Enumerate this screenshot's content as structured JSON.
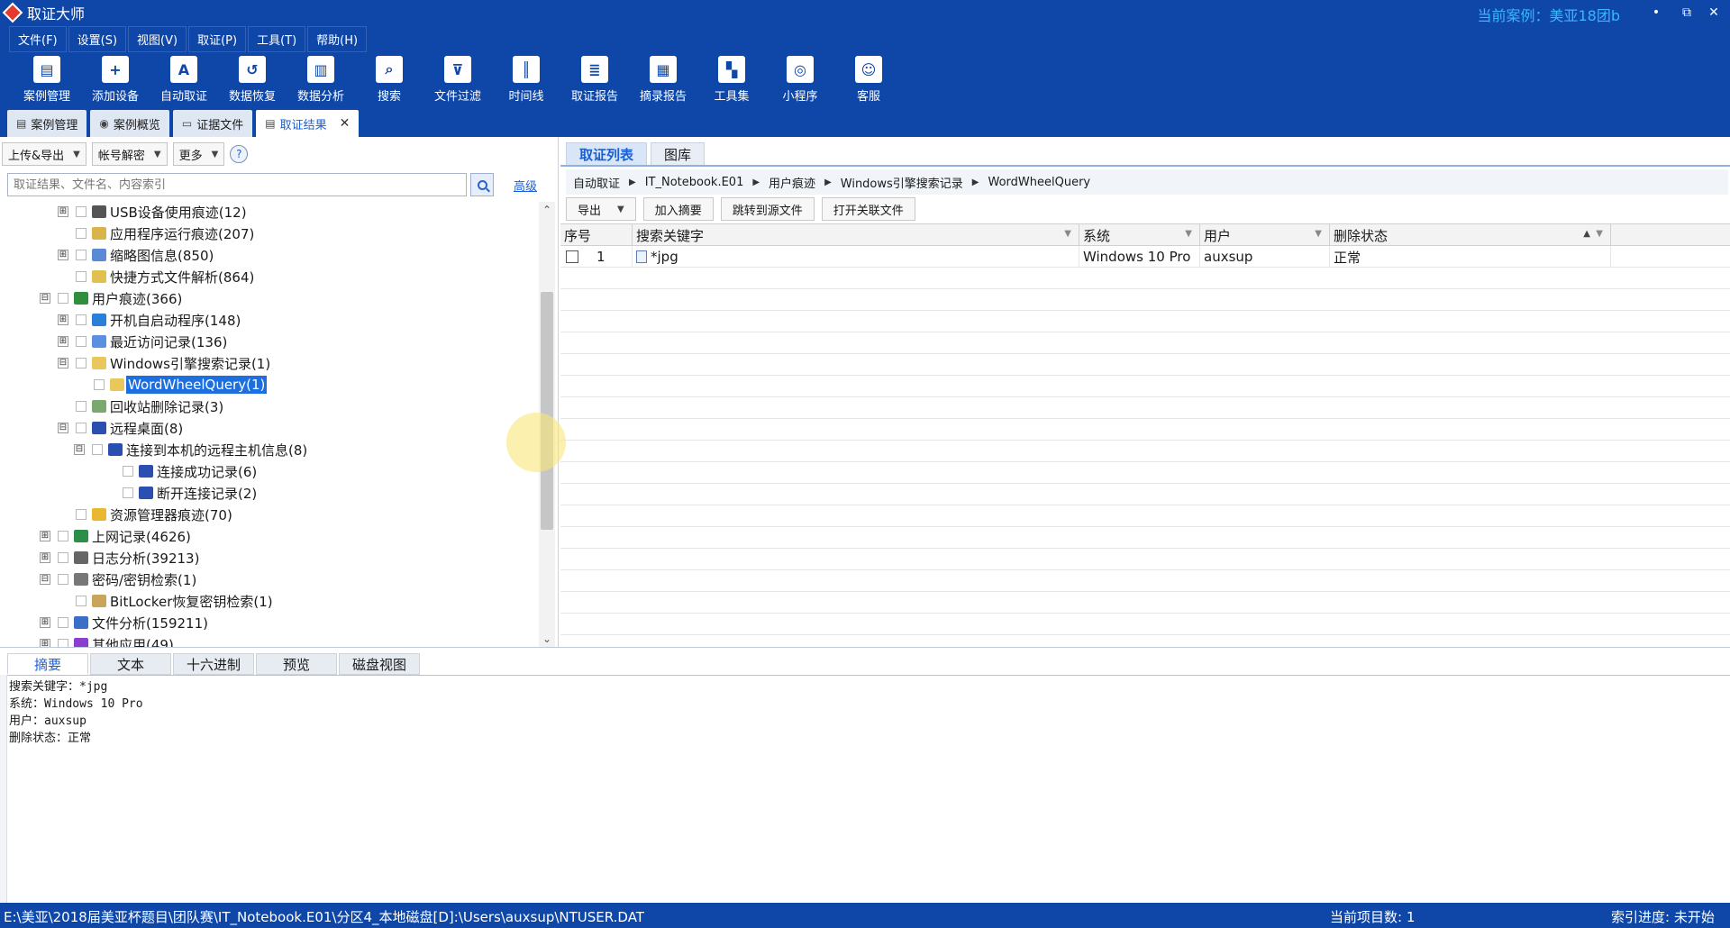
{
  "window": {
    "title": "取证大师",
    "current_case": "当前案例：美亚18团b",
    "minimize": "•",
    "restore": "⧉",
    "close": "✕"
  },
  "menu": [
    "文件(F)",
    "设置(S)",
    "视图(V)",
    "取证(P)",
    "工具(T)",
    "帮助(H)"
  ],
  "ribbon": [
    {
      "label": "案例管理",
      "icon": "folder-icon"
    },
    {
      "label": "添加设备",
      "icon": "add-device-icon"
    },
    {
      "label": "自动取证",
      "icon": "auto-icon"
    },
    {
      "label": "数据恢复",
      "icon": "recover-icon"
    },
    {
      "label": "数据分析",
      "icon": "analysis-icon"
    },
    {
      "label": "搜索",
      "icon": "search-icon"
    },
    {
      "label": "文件过滤",
      "icon": "filter-icon"
    },
    {
      "label": "时间线",
      "icon": "timeline-icon"
    },
    {
      "label": "取证报告",
      "icon": "report-icon"
    },
    {
      "label": "摘录报告",
      "icon": "excerpt-icon"
    },
    {
      "label": "工具集",
      "icon": "tools-icon"
    },
    {
      "label": "小程序",
      "icon": "miniapp-icon"
    },
    {
      "label": "客服",
      "icon": "support-icon"
    }
  ],
  "doc_tabs": [
    "案例管理",
    "案例概览",
    "证据文件",
    "取证结果"
  ],
  "left": {
    "upload_export": "上传&导出",
    "account_decrypt": "帐号解密",
    "more": "更多",
    "help": "?",
    "search_placeholder": "取证结果、文件名、内容索引",
    "advanced": "高级"
  },
  "tree": [
    {
      "label": "USB设备使用痕迹(12)",
      "exp": "⊞"
    },
    {
      "label": "应用程序运行痕迹(207)",
      "exp": ""
    },
    {
      "label": "缩略图信息(850)",
      "exp": "⊞"
    },
    {
      "label": "快捷方式文件解析(864)",
      "exp": ""
    },
    {
      "label": "用户痕迹(366)",
      "exp": "⊟"
    },
    {
      "label": "开机自启动程序(148)",
      "exp": "⊞"
    },
    {
      "label": "最近访问记录(136)",
      "exp": "⊞"
    },
    {
      "label": "Windows引擎搜索记录(1)",
      "exp": "⊟"
    },
    {
      "label": "WordWheelQuery(1)",
      "exp": ""
    },
    {
      "label": "回收站删除记录(3)",
      "exp": ""
    },
    {
      "label": "远程桌面(8)",
      "exp": "⊟"
    },
    {
      "label": "连接到本机的远程主机信息(8)",
      "exp": "⊟"
    },
    {
      "label": "连接成功记录(6)",
      "exp": ""
    },
    {
      "label": "断开连接记录(2)",
      "exp": ""
    },
    {
      "label": "资源管理器痕迹(70)",
      "exp": ""
    },
    {
      "label": "上网记录(4626)",
      "exp": "⊞"
    },
    {
      "label": "日志分析(39213)",
      "exp": "⊞"
    },
    {
      "label": "密码/密钥检索(1)",
      "exp": "⊟"
    },
    {
      "label": "BitLocker恢复密钥检索(1)",
      "exp": ""
    },
    {
      "label": "文件分析(159211)",
      "exp": "⊞"
    },
    {
      "label": "其他应用(49)",
      "exp": "⊞"
    }
  ],
  "right": {
    "tabs": [
      "取证列表",
      "图库"
    ],
    "breadcrumb": [
      "自动取证",
      "IT_Notebook.E01",
      "用户痕迹",
      "Windows引擎搜索记录",
      "WordWheelQuery"
    ],
    "export": "导出",
    "add_summary": "加入摘要",
    "jump_source": "跳转到源文件",
    "open_related": "打开关联文件",
    "columns": [
      "序号",
      "搜索关键字",
      "系统",
      "用户",
      "删除状态"
    ],
    "rows": [
      {
        "index": "1",
        "keyword": "*jpg",
        "system": "Windows 10 Pro",
        "user": "auxsup",
        "deleted": "正常"
      }
    ]
  },
  "bottom": {
    "tabs": [
      "摘要",
      "文本",
      "十六进制",
      "预览",
      "磁盘视图"
    ],
    "summary_lines": [
      "搜索关键字：*jpg",
      "系统：Windows 10 Pro",
      "用户：auxsup",
      "删除状态：正常"
    ]
  },
  "status": {
    "path": "E:\\美亚\\2018届美亚杯题目\\团队赛\\IT_Notebook.E01\\分区4_本地磁盘[D]:\\Users\\auxsup\\NTUSER.DAT",
    "item_count": "当前项目数: 1",
    "index_progress": "索引进度: 未开始"
  }
}
